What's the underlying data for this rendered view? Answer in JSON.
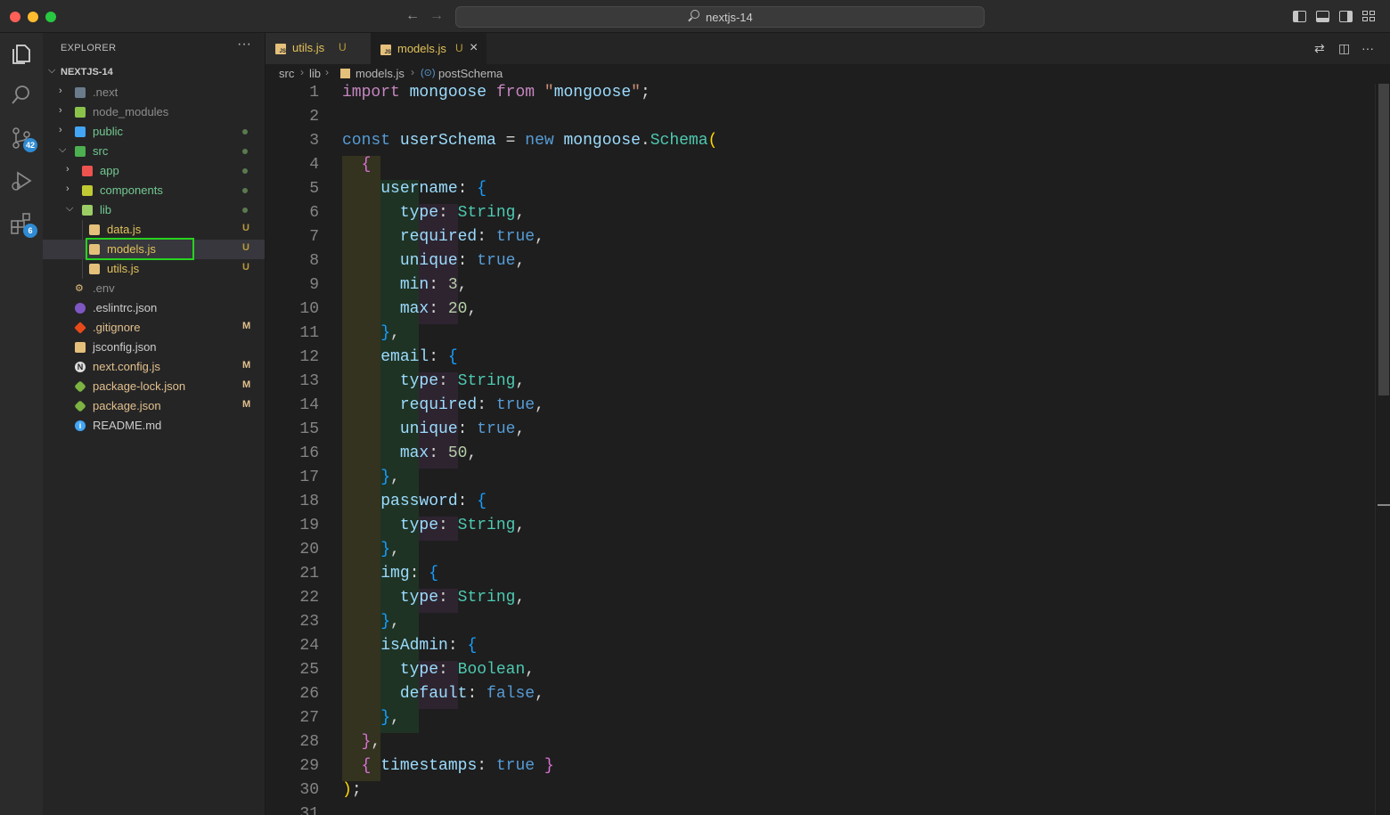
{
  "window": {
    "search_text": "nextjs-14"
  },
  "activity_bar": {
    "source_control_badge": "42",
    "extensions_badge": "6"
  },
  "explorer": {
    "title": "EXPLORER",
    "more": "···",
    "root": "NEXTJS-14",
    "items": [
      {
        "label": ".next",
        "status": ""
      },
      {
        "label": "node_modules",
        "status": ""
      },
      {
        "label": "public",
        "status": "dot"
      },
      {
        "label": "src",
        "status": "dot"
      },
      {
        "label": "app",
        "status": "dot"
      },
      {
        "label": "components",
        "status": "dot"
      },
      {
        "label": "lib",
        "status": "dot"
      },
      {
        "label": "data.js",
        "status": "U"
      },
      {
        "label": "models.js",
        "status": "U"
      },
      {
        "label": "utils.js",
        "status": "U"
      },
      {
        "label": ".env",
        "status": ""
      },
      {
        "label": ".eslintrc.json",
        "status": ""
      },
      {
        "label": ".gitignore",
        "status": "M"
      },
      {
        "label": "jsconfig.json",
        "status": ""
      },
      {
        "label": "next.config.js",
        "status": "M"
      },
      {
        "label": "package-lock.json",
        "status": "M"
      },
      {
        "label": "package.json",
        "status": "M"
      },
      {
        "label": "README.md",
        "status": ""
      }
    ]
  },
  "tabs": [
    {
      "label": "utils.js",
      "status": "U",
      "active": false
    },
    {
      "label": "models.js",
      "status": "U",
      "active": true
    }
  ],
  "breadcrumb": [
    "src",
    "lib",
    "models.js",
    "postSchema"
  ],
  "editor": {
    "line_numbers": [
      "1",
      "2",
      "3",
      "4",
      "5",
      "6",
      "7",
      "8",
      "9",
      "10",
      "11",
      "12",
      "13",
      "14",
      "15",
      "16",
      "17",
      "18",
      "19",
      "20",
      "21",
      "22",
      "23",
      "24",
      "25",
      "26",
      "27",
      "28",
      "29",
      "30",
      "31"
    ],
    "code": [
      "import mongoose from \"mongoose\";",
      "",
      "const userSchema = new mongoose.Schema(",
      "  {",
      "    username: {",
      "      type: String,",
      "      required: true,",
      "      unique: true,",
      "      min: 3,",
      "      max: 20,",
      "    },",
      "    email: {",
      "      type: String,",
      "      required: true,",
      "      unique: true,",
      "      max: 50,",
      "    },",
      "    password: {",
      "      type: String,",
      "    },",
      "    img: {",
      "      type: String,",
      "    },",
      "    isAdmin: {",
      "      type: Boolean,",
      "      default: false,",
      "    },",
      "  },",
      "  { timestamps: true }",
      ");",
      ""
    ]
  },
  "colors": {
    "selection_highlight": "#28d220",
    "badge": "#2f8bd3",
    "untracked": "#b89b3c"
  }
}
